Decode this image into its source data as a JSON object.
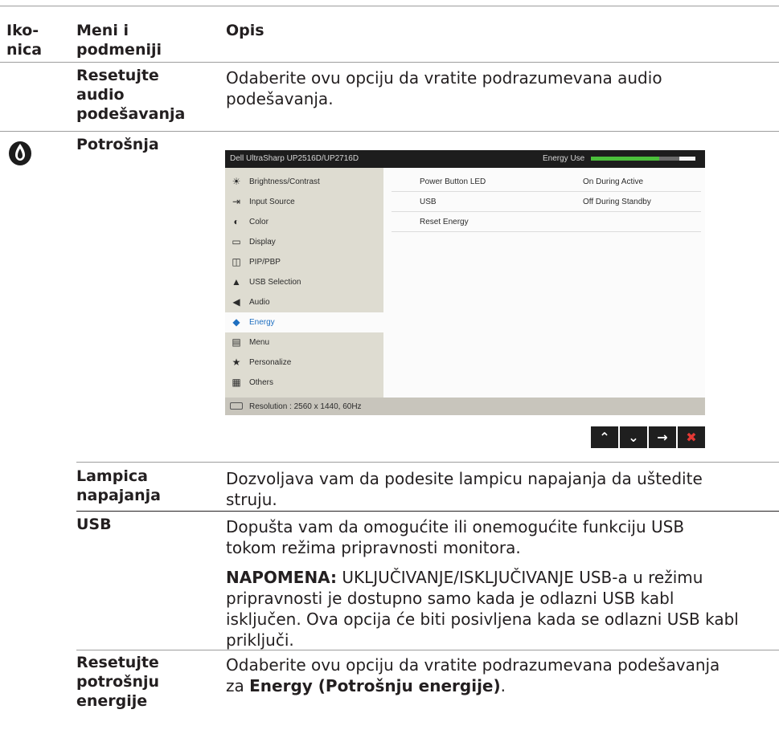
{
  "header": {
    "col1": "Iko-\nnica",
    "col2": "Meni i\npodmeniji",
    "col3": "Opis"
  },
  "rows": {
    "reset_audio": {
      "name": "Resetujte\naudio\npodešavanja",
      "desc": "Odaberite ovu opciju da vratite podrazumevana audio\npodešavanja."
    },
    "energy": {
      "name": "Potrošnja",
      "icon": "energy-drop-icon"
    },
    "power_led": {
      "name": "Lampica\nnapajanja",
      "desc": "Dozvoljava vam da podesite lampicu napajanja da uštedite\nstruju."
    },
    "usb": {
      "name": "USB",
      "desc": "Dopušta vam da omogućite ili onemogućite funkciju USB\ntokom režima pripravnosti monitora.",
      "note_label": "NAPOMENA:",
      "note_first": " UKLJUČIVANJE/ISKLJUČIVANJE USB-a u režimu",
      "note_rest": "pripravnosti je dostupno samo kada je odlazni USB kabl\nisključen. Ova opcija će biti posivljena kada se odlazni USB kabl\npriključi."
    },
    "reset_energy": {
      "name": "Resetujte\npotrošnju\nenergije",
      "desc_line1": "Odaberite ovu opciju da vratite podrazumevana podešavanja",
      "desc_pre": "za ",
      "desc_bold": "Energy (Potrošnju energije)",
      "desc_post": "."
    }
  },
  "osd": {
    "model": "Dell UltraSharp UP2516D/UP2716D",
    "energy_use_label": "Energy Use",
    "energy_use_level": 0.82,
    "menu": [
      {
        "label": "Brightness/Contrast",
        "icon": "brightness-icon"
      },
      {
        "label": "Input Source",
        "icon": "input-source-icon"
      },
      {
        "label": "Color",
        "icon": "color-icon"
      },
      {
        "label": "Display",
        "icon": "display-icon"
      },
      {
        "label": "PIP/PBP",
        "icon": "pip-icon"
      },
      {
        "label": "USB Selection",
        "icon": "usb-selection-icon"
      },
      {
        "label": "Audio",
        "icon": "audio-icon"
      },
      {
        "label": "Energy",
        "icon": "energy-icon"
      },
      {
        "label": "Menu",
        "icon": "menu-icon"
      },
      {
        "label": "Personalize",
        "icon": "star-icon"
      },
      {
        "label": "Others",
        "icon": "others-icon"
      }
    ],
    "selected_index": 7,
    "settings": [
      {
        "key": "Power Button LED",
        "value": "On During Active"
      },
      {
        "key": "USB",
        "value": "Off During Standby"
      },
      {
        "key": "Reset Energy",
        "value": ""
      }
    ],
    "resolution": "Resolution : 2560 x 1440, 60Hz",
    "nav_buttons": [
      {
        "name": "up-button",
        "icon": "chevron-up-icon",
        "glyph": "⌃"
      },
      {
        "name": "down-button",
        "icon": "chevron-down-icon",
        "glyph": "⌄"
      },
      {
        "name": "right-button",
        "icon": "arrow-right-icon",
        "glyph": "→"
      },
      {
        "name": "close-button",
        "icon": "close-icon",
        "glyph": "✖"
      }
    ],
    "colors": {
      "energy_bar": "#4bbf3b",
      "selected_text": "#1e6fc0",
      "close": "#e53935"
    }
  }
}
